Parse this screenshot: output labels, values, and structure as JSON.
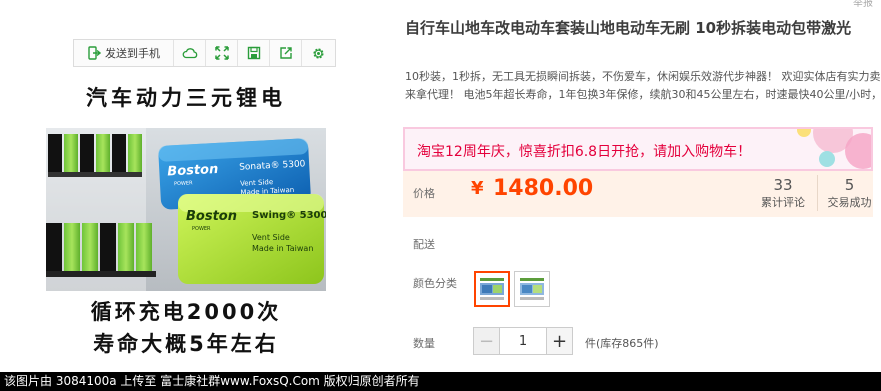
{
  "toolbar": {
    "send_to_phone": "发送到手机",
    "icons": [
      "cloud-icon",
      "expand-icon",
      "save-icon",
      "share-icon",
      "settings-icon"
    ]
  },
  "product_image": {
    "caption_top": "汽车动力三元锂电",
    "caption_line1": "循环充电2000次",
    "caption_line2": "寿命大概5年左右",
    "battery_blue": {
      "brand": "Boston",
      "brand_sub": "POWER",
      "model": "Sonata® 5300",
      "line1": "Vent Side",
      "line2": "Made in Taiwan"
    },
    "battery_green": {
      "brand": "Boston",
      "brand_sub": "POWER",
      "model": "Swing® 5300",
      "line1": "Vent Side",
      "line2": "Made in Taiwan"
    }
  },
  "product": {
    "report": "举报",
    "title": "自行车山地车改电动车套装山地电动车无刷 10秒拆装电动包带激光",
    "subtitle": "10秒装，1秒拆，无工具无损瞬间拆装，不伤爱车，休闲娱乐效游代步神器！ 欢迎实体店有实力卖来拿代理！ 电池5年超长寿命，1年包换3年保修，续航30和45公里左右，时速最快40公里/小时，"
  },
  "promo": {
    "text": "淘宝12周年庆，惊喜折扣6.8日开抢，请加入购物车！"
  },
  "price": {
    "label": "价格",
    "currency": "¥",
    "value": "1480.00",
    "reviews_count": "33",
    "reviews_label": "累计评论",
    "trades_count": "5",
    "trades_label": "交易成功"
  },
  "delivery": {
    "label": "配送"
  },
  "color": {
    "label": "颜色分类",
    "options_count": 2,
    "selected_index": 0
  },
  "quantity": {
    "label": "数量",
    "value": "1",
    "minus": "−",
    "plus": "+",
    "stock": "件(库存865件)"
  },
  "footer": {
    "text": "该图片由 3084100a 上传至 富士康社群www.FoxsQ.Com 版权归原创者所有"
  },
  "colors": {
    "accent": "#ff4400",
    "promo_text": "#e4003c",
    "price_bg": "#fff2e8",
    "toolbar_icon": "#2a9d3a"
  }
}
